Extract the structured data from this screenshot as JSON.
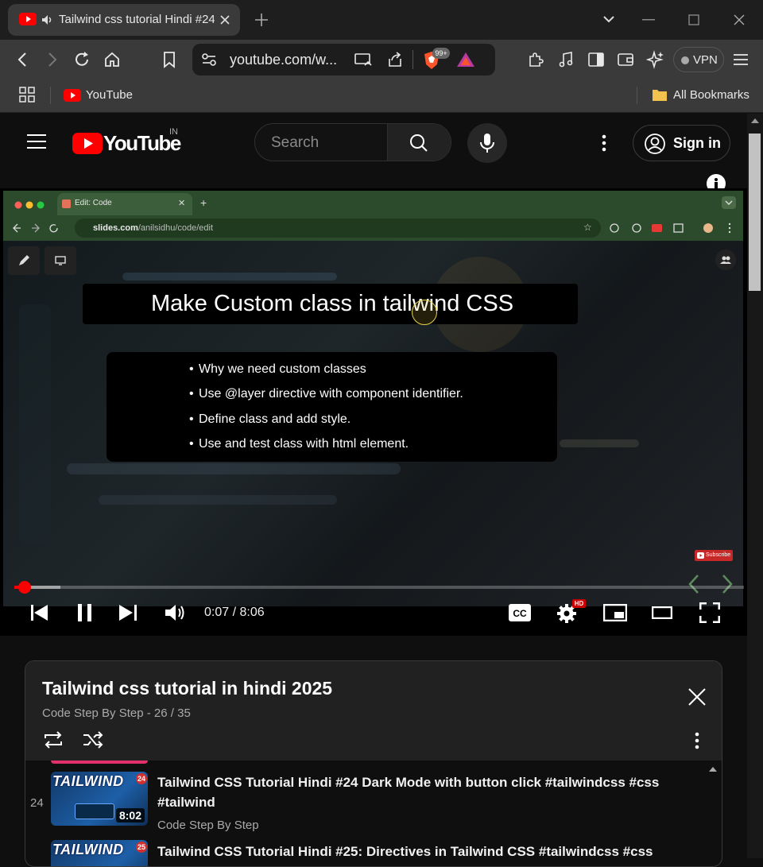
{
  "browser": {
    "tab_title": "Tailwind css tutorial Hindi #24",
    "url": "youtube.com/w...",
    "brave_badge": "99+",
    "vpn_label": "VPN",
    "bookmark_youtube": "YouTube",
    "all_bookmarks": "All Bookmarks"
  },
  "youtube": {
    "logo_text": "YouTube",
    "region": "IN",
    "search_placeholder": "Search",
    "signin_label": "Sign in"
  },
  "video": {
    "inner_tab_title": "Edit: Code",
    "inner_url_prefix": "slides.com",
    "inner_url_path": "/anilsidhu/code/edit",
    "slide_title": "Make Custom class in tailwind CSS",
    "bullets": [
      "Why we need custom classes",
      "Use @layer directive with component identifier.",
      "Define class and add style.",
      "Use and test class with html element."
    ],
    "subscribe_label": "Subscribe",
    "time": "0:07 / 8:06",
    "hd_badge": "HD",
    "progress_played": 0.0144,
    "progress_buffered": 0.063
  },
  "playlist": {
    "title": "Tailwind css tutorial in hindi 2025",
    "subtitle": "Code Step By Step - 26 / 35",
    "items": [
      {
        "num": "24",
        "thumb_title": "TAILWIND",
        "thumb_num": "24",
        "duration": "8:02",
        "title": "Tailwind CSS Tutorial Hindi #24 Dark Mode with button click #tailwindcss #css #tailwind",
        "channel": "Code Step By Step"
      },
      {
        "num": "",
        "thumb_title": "TAILWIND",
        "thumb_num": "25",
        "duration": "",
        "title": "Tailwind CSS Tutorial Hindi #25: Directives in Tailwind CSS #tailwindcss #css",
        "channel": ""
      }
    ]
  },
  "colors": {
    "youtube_red": "#ff0000",
    "progress_red": "#ff0000",
    "chrome_bg": "#3a3a3a"
  }
}
